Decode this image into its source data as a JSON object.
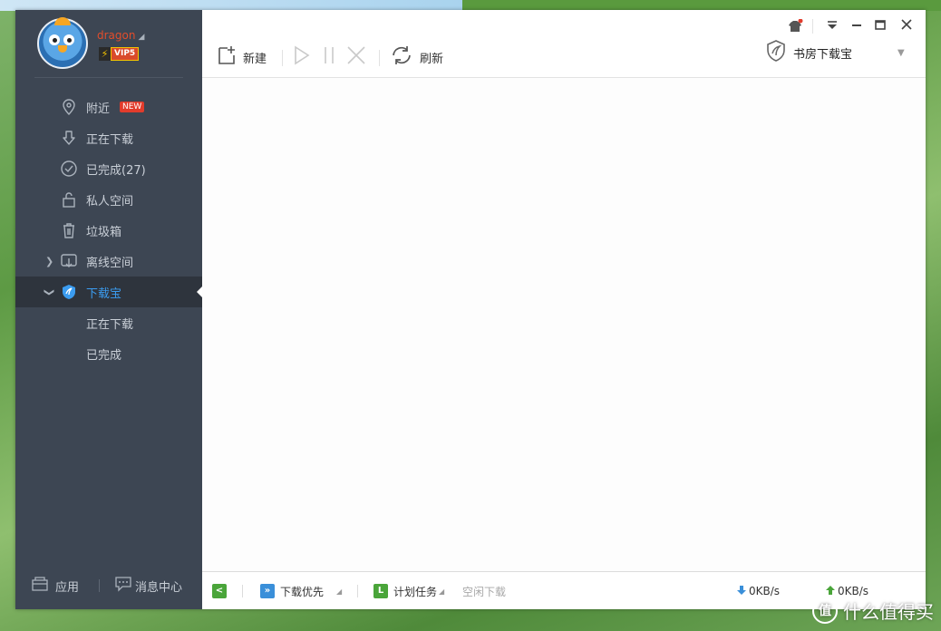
{
  "user": {
    "name": "dragon",
    "vip_label": "VIP5",
    "vip_bolt": "⚡"
  },
  "sidebar": {
    "items": [
      {
        "label": "附近",
        "badge": "NEW"
      },
      {
        "label": "正在下载"
      },
      {
        "label": "已完成(27)"
      },
      {
        "label": "私人空间"
      },
      {
        "label": "垃圾箱"
      },
      {
        "label": "离线空间"
      },
      {
        "label": "下载宝"
      }
    ],
    "subitems": [
      {
        "label": "正在下载"
      },
      {
        "label": "已完成"
      }
    ],
    "footer": {
      "app_label": "应用",
      "msg_label": "消息中心"
    }
  },
  "toolbar": {
    "new_label": "新建",
    "refresh_label": "刷新",
    "device_label": "书房下载宝"
  },
  "statusbar": {
    "priority_label": "下载优先",
    "schedule_label": "计划任务",
    "idle_label": "空闲下载",
    "down_speed": "0KB/s",
    "up_speed": "0KB/s"
  },
  "watermark": {
    "text": "什么值得买",
    "logo": "值"
  },
  "colors": {
    "sidebar_bg": "#3d4653",
    "active_text": "#3b9cf0",
    "accent_red": "#e23c2c"
  }
}
